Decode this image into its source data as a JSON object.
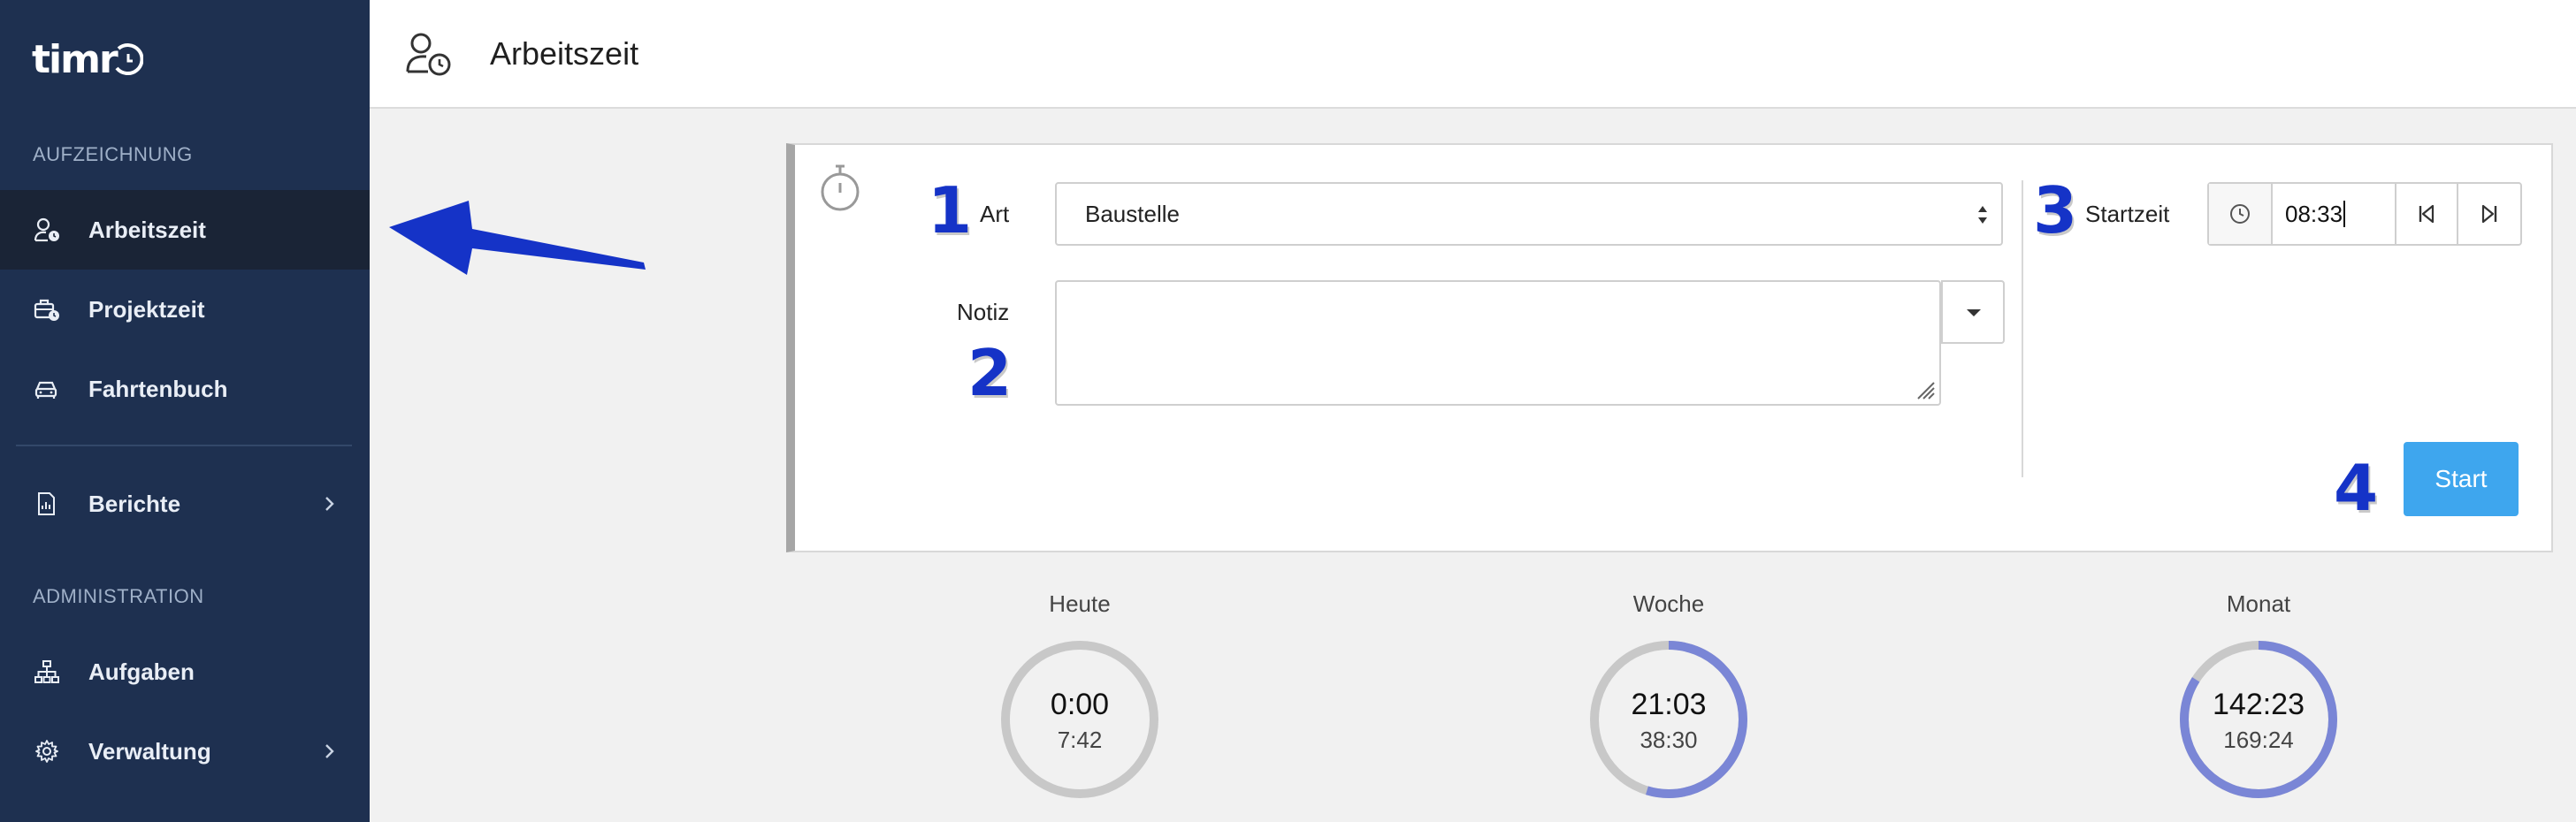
{
  "app": {
    "logo_text": "timr",
    "page_title": "Arbeitszeit"
  },
  "sidebar": {
    "section_recording": "AUFZEICHNUNG",
    "section_admin": "ADMINISTRATION",
    "items": [
      {
        "label": "Arbeitszeit",
        "icon": "user-clock-icon",
        "active": true
      },
      {
        "label": "Projektzeit",
        "icon": "briefcase-clock-icon"
      },
      {
        "label": "Fahrtenbuch",
        "icon": "car-icon"
      },
      {
        "label": "Berichte",
        "icon": "report-icon",
        "has_submenu": true
      },
      {
        "label": "Aufgaben",
        "icon": "hierarchy-icon"
      },
      {
        "label": "Verwaltung",
        "icon": "gear-icon",
        "has_submenu": true
      }
    ]
  },
  "form": {
    "art_label": "Art",
    "art_value": "Baustelle",
    "notiz_label": "Notiz",
    "notiz_value": "",
    "startzeit_label": "Startzeit",
    "startzeit_value": "08:33",
    "start_button": "Start"
  },
  "annotations": {
    "step1": "1",
    "step2": "2",
    "step3": "3",
    "step4": "4",
    "arrow_color": "#1533c7"
  },
  "stats": [
    {
      "label": "Heute",
      "value": "0:00",
      "target": "7:42",
      "progress": 0.0
    },
    {
      "label": "Woche",
      "value": "21:03",
      "target": "38:30",
      "progress": 0.547
    },
    {
      "label": "Monat",
      "value": "142:23",
      "target": "169:24",
      "progress": 0.84
    }
  ],
  "colors": {
    "sidebar_bg": "#1e3050",
    "accent": "#3ea6ee",
    "ring_fill": "#7a86d6",
    "ring_track": "#c8c8c8"
  }
}
